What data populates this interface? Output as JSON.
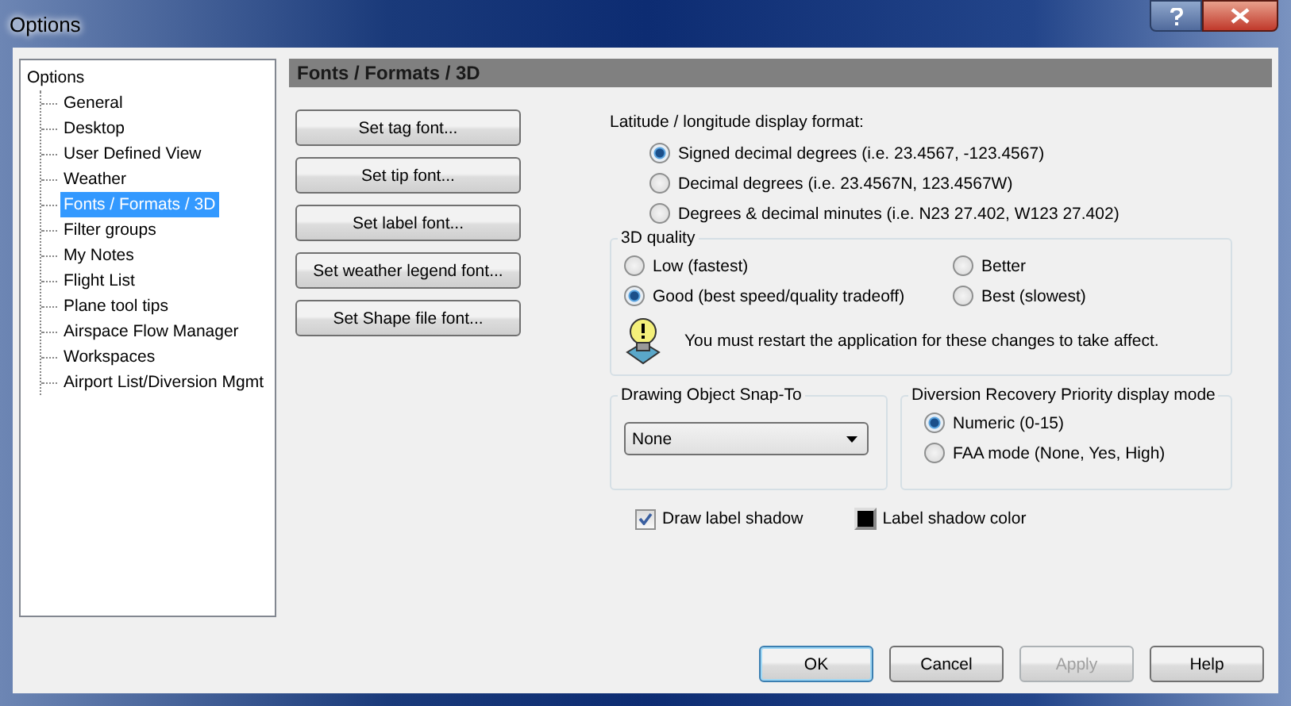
{
  "window": {
    "title": "Options"
  },
  "tree": {
    "label": "Options",
    "children": [
      {
        "label": "General",
        "selected": false
      },
      {
        "label": "Desktop",
        "selected": false
      },
      {
        "label": "User Defined View",
        "selected": false
      },
      {
        "label": "Weather",
        "selected": false
      },
      {
        "label": "Fonts / Formats / 3D",
        "selected": true
      },
      {
        "label": "Filter groups",
        "selected": false
      },
      {
        "label": "My Notes",
        "selected": false
      },
      {
        "label": "Flight List",
        "selected": false
      },
      {
        "label": "Plane tool tips",
        "selected": false
      },
      {
        "label": "Airspace Flow Manager",
        "selected": false
      },
      {
        "label": "Workspaces",
        "selected": false
      },
      {
        "label": "Airport List/Diversion Mgmt",
        "selected": false
      }
    ]
  },
  "header": "Fonts / Formats / 3D",
  "font_buttons": [
    "Set tag font...",
    "Set tip font...",
    "Set label font...",
    "Set weather legend font...",
    "Set Shape file font..."
  ],
  "latlon": {
    "label": "Latitude / longitude display format:",
    "options": [
      {
        "label": "Signed decimal degrees (i.e. 23.4567, -123.4567)",
        "selected": true
      },
      {
        "label": "Decimal degrees (i.e. 23.4567N, 123.4567W)",
        "selected": false
      },
      {
        "label": "Degrees & decimal minutes (i.e. N23 27.402, W123 27.402)",
        "selected": false
      }
    ]
  },
  "quality": {
    "title": "3D quality",
    "options": [
      {
        "label": "Low (fastest)",
        "selected": false
      },
      {
        "label": "Better",
        "selected": false
      },
      {
        "label": "Good (best speed/quality tradeoff)",
        "selected": true
      },
      {
        "label": "Best (slowest)",
        "selected": false
      }
    ],
    "note": "You must restart the application for these changes to take affect."
  },
  "snap": {
    "title": "Drawing Object Snap-To",
    "value": "None"
  },
  "diversion": {
    "title": "Diversion Recovery Priority display mode",
    "options": [
      {
        "label": "Numeric (0-15)",
        "selected": true
      },
      {
        "label": "FAA mode (None, Yes, High)",
        "selected": false
      }
    ]
  },
  "shadow": {
    "label": "Draw label shadow",
    "checked": true
  },
  "shadow_color": {
    "label": "Label shadow color",
    "color": "#000000"
  },
  "buttons": [
    {
      "label": "OK",
      "default": true,
      "disabled": false
    },
    {
      "label": "Cancel",
      "default": false,
      "disabled": false
    },
    {
      "label": "Apply",
      "default": false,
      "disabled": true
    },
    {
      "label": "Help",
      "default": false,
      "disabled": false
    }
  ]
}
